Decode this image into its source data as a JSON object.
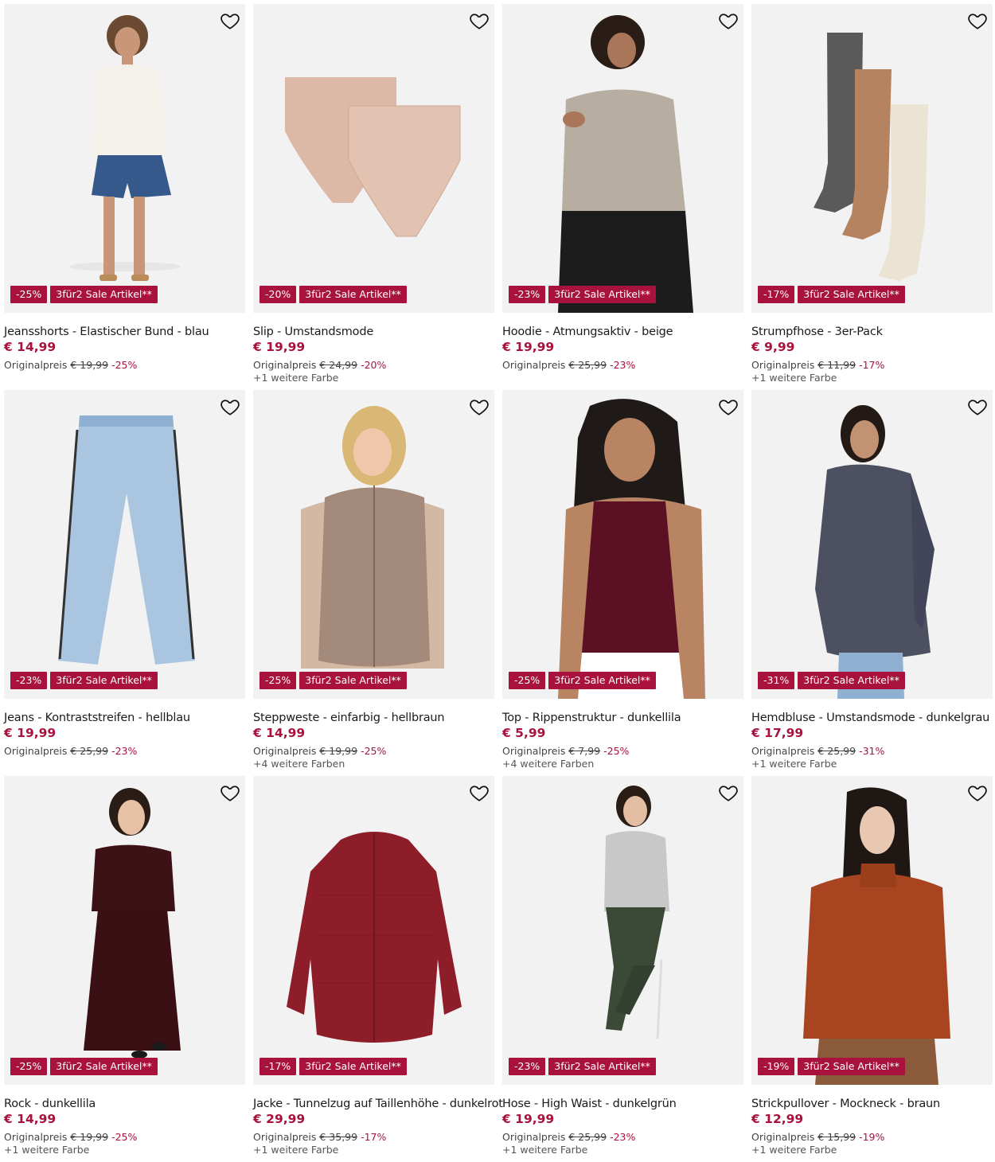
{
  "colors": {
    "accent": "#a8123d",
    "image_bg": "#f2f2f2",
    "text": "#1a1a1a"
  },
  "labels": {
    "original_price": "Originalpreis",
    "sale_tag": "3für2 Sale Artikel**"
  },
  "products": [
    {
      "name": "Jeansshorts - Elastischer Bund - blau",
      "price": "€ 14,99",
      "old_price": "€ 19,99",
      "discount": "-25%",
      "more_colors": "",
      "image": "model-white-top-denim-shorts"
    },
    {
      "name": "Slip - Umstandsmode",
      "price": "€ 19,99",
      "old_price": "€ 24,99",
      "discount": "-20%",
      "more_colors": "+1 weitere Farbe",
      "image": "two-beige-briefs"
    },
    {
      "name": "Hoodie - Atmungsaktiv - beige",
      "price": "€ 19,99",
      "old_price": "€ 25,99",
      "discount": "-23%",
      "more_colors": "",
      "image": "model-beige-hoodie"
    },
    {
      "name": "Strumpfhose - 3er-Pack",
      "price": "€ 9,99",
      "old_price": "€ 11,99",
      "discount": "-17%",
      "more_colors": "+1 weitere Farbe",
      "image": "three-tights"
    },
    {
      "name": "Jeans - Kontraststreifen - hellblau",
      "price": "€ 19,99",
      "old_price": "€ 25,99",
      "discount": "-23%",
      "more_colors": "",
      "image": "light-blue-jeans"
    },
    {
      "name": "Steppweste - einfarbig - hellbraun",
      "price": "€ 14,99",
      "old_price": "€ 19,99",
      "discount": "-25%",
      "more_colors": "+4 weitere Farben",
      "image": "model-puffer-vest"
    },
    {
      "name": "Top - Rippenstruktur - dunkellila",
      "price": "€ 5,99",
      "old_price": "€ 7,99",
      "discount": "-25%",
      "more_colors": "+4 weitere Farben",
      "image": "model-burgundy-tank"
    },
    {
      "name": "Hemdbluse - Umstandsmode - dunkelgrau",
      "price": "€ 17,99",
      "old_price": "€ 25,99",
      "discount": "-31%",
      "more_colors": "+1 weitere Farbe",
      "image": "model-floral-blouse"
    },
    {
      "name": "Rock - dunkellila",
      "price": "€ 14,99",
      "old_price": "€ 19,99",
      "discount": "-25%",
      "more_colors": "+1 weitere Farbe",
      "image": "model-knit-skirt"
    },
    {
      "name": "Jacke - Tunnelzug auf Taillenhöhe - dunkelrot",
      "price": "€ 29,99",
      "old_price": "€ 35,99",
      "discount": "-17%",
      "more_colors": "+1 weitere Farbe",
      "image": "red-puffer-jacket"
    },
    {
      "name": "Hose - High Waist - dunkelgrün",
      "price": "€ 19,99",
      "old_price": "€ 25,99",
      "discount": "-23%",
      "more_colors": "+1 weitere Farbe",
      "image": "model-green-leggings"
    },
    {
      "name": "Strickpullover - Mockneck - braun",
      "price": "€ 12,99",
      "old_price": "€ 15,99",
      "discount": "-19%",
      "more_colors": "+1 weitere Farbe",
      "image": "model-rust-sweater"
    }
  ]
}
